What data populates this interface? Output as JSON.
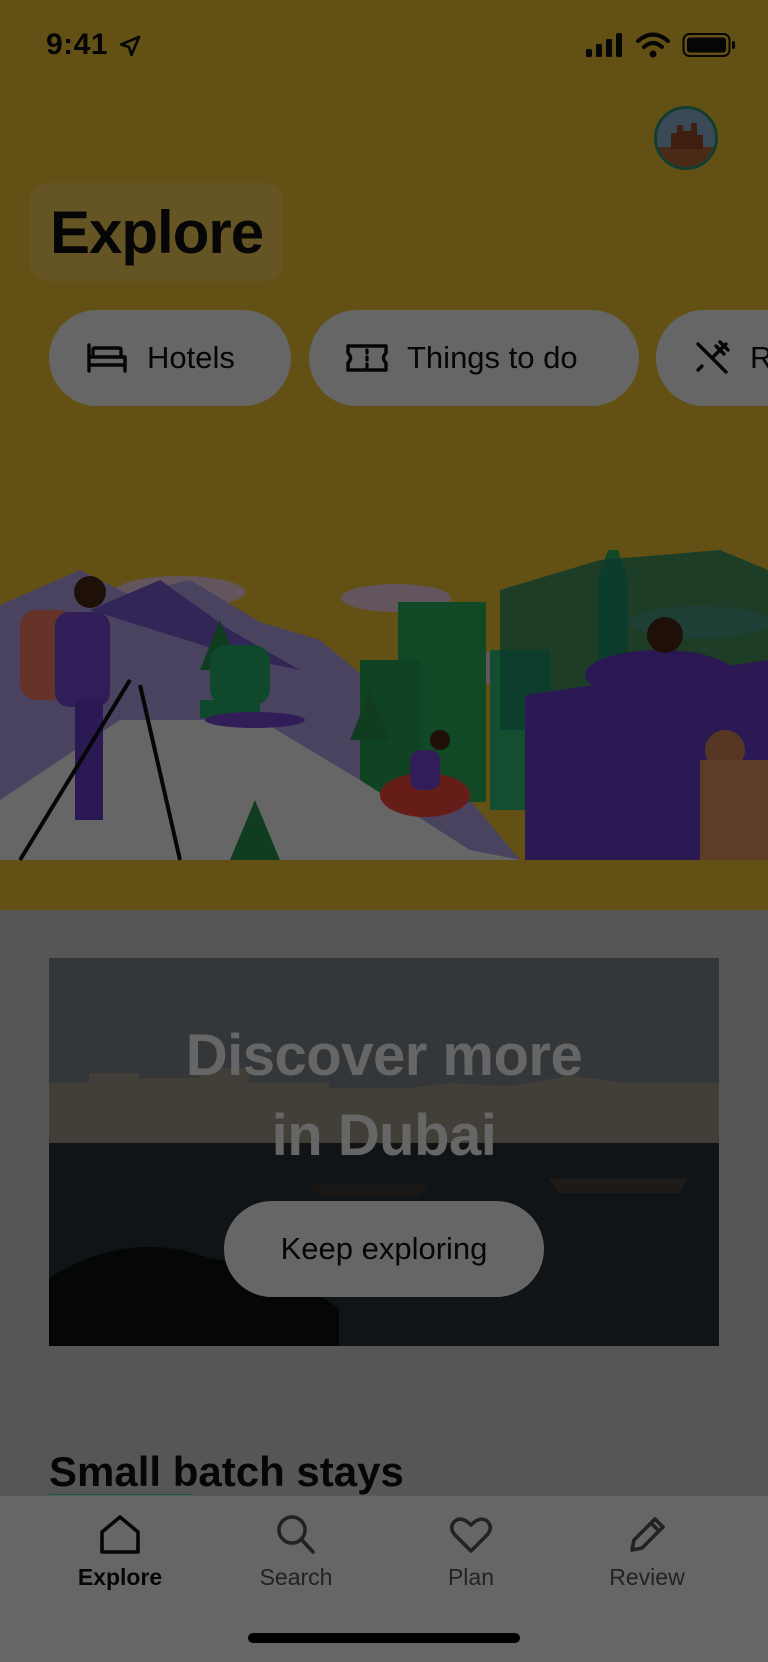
{
  "status_bar": {
    "time": "9:41"
  },
  "header": {
    "title": "Explore"
  },
  "categories": [
    {
      "label": "Hotels",
      "icon": "bed-icon"
    },
    {
      "label": "Things to do",
      "icon": "ticket-icon"
    },
    {
      "label": "R",
      "icon": "utensils-icon"
    }
  ],
  "promo": {
    "title_line1": "Discover more",
    "title_line2": "in Dubai",
    "button": "Keep exploring"
  },
  "section": {
    "title": "Small batch stays"
  },
  "tabs": [
    {
      "label": "Explore",
      "icon": "home-icon",
      "active": true
    },
    {
      "label": "Search",
      "icon": "search-icon",
      "active": false
    },
    {
      "label": "Plan",
      "icon": "heart-icon",
      "active": false
    },
    {
      "label": "Review",
      "icon": "pencil-icon",
      "active": false
    }
  ],
  "colors": {
    "brand_yellow": "#f7c935",
    "accent_green": "#34e0a1"
  }
}
